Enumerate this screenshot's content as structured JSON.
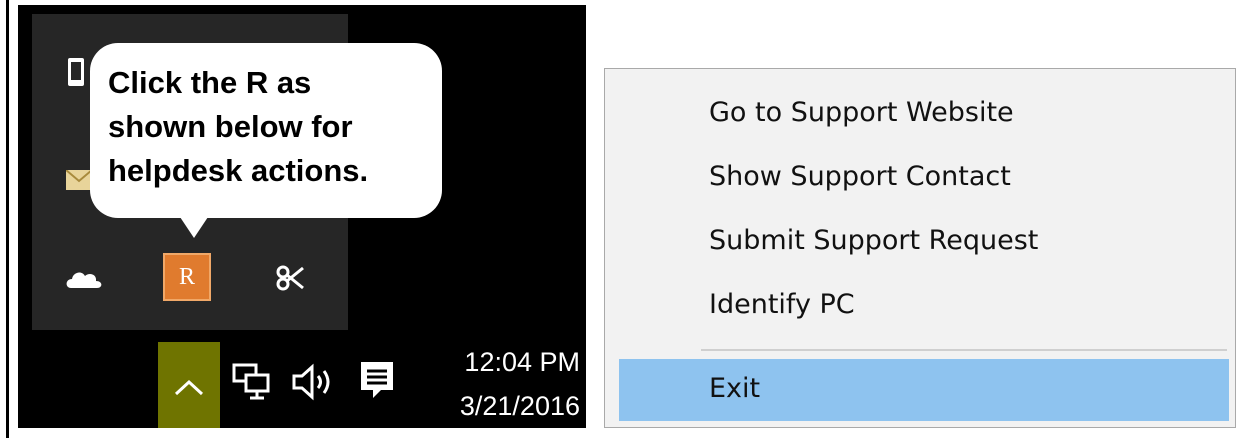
{
  "callout": {
    "lines": [
      "Click the R as",
      "shown below for",
      "helpdesk actions."
    ]
  },
  "tray": {
    "overflow_icons": [
      "phone-icon",
      "mail-icon",
      "onedrive-icon",
      "r-app-icon",
      "snip-icon"
    ],
    "r_icon_letter": "R",
    "system_icons": [
      "chevron-up-icon",
      "network-icon",
      "volume-icon",
      "action-center-icon"
    ],
    "show_hidden_button_color": "#6f7400",
    "r_icon_color": "#e07b2e"
  },
  "clock": {
    "time": "12:04 PM",
    "date": "3/21/2016"
  },
  "context_menu": {
    "items": [
      {
        "label": "Go to Support Website"
      },
      {
        "label": "Show Support Contact"
      },
      {
        "label": "Submit Support Request"
      },
      {
        "label": "Identify PC"
      },
      {
        "label": "Exit",
        "highlighted": true
      }
    ],
    "highlight_color": "#8ec3ef"
  }
}
